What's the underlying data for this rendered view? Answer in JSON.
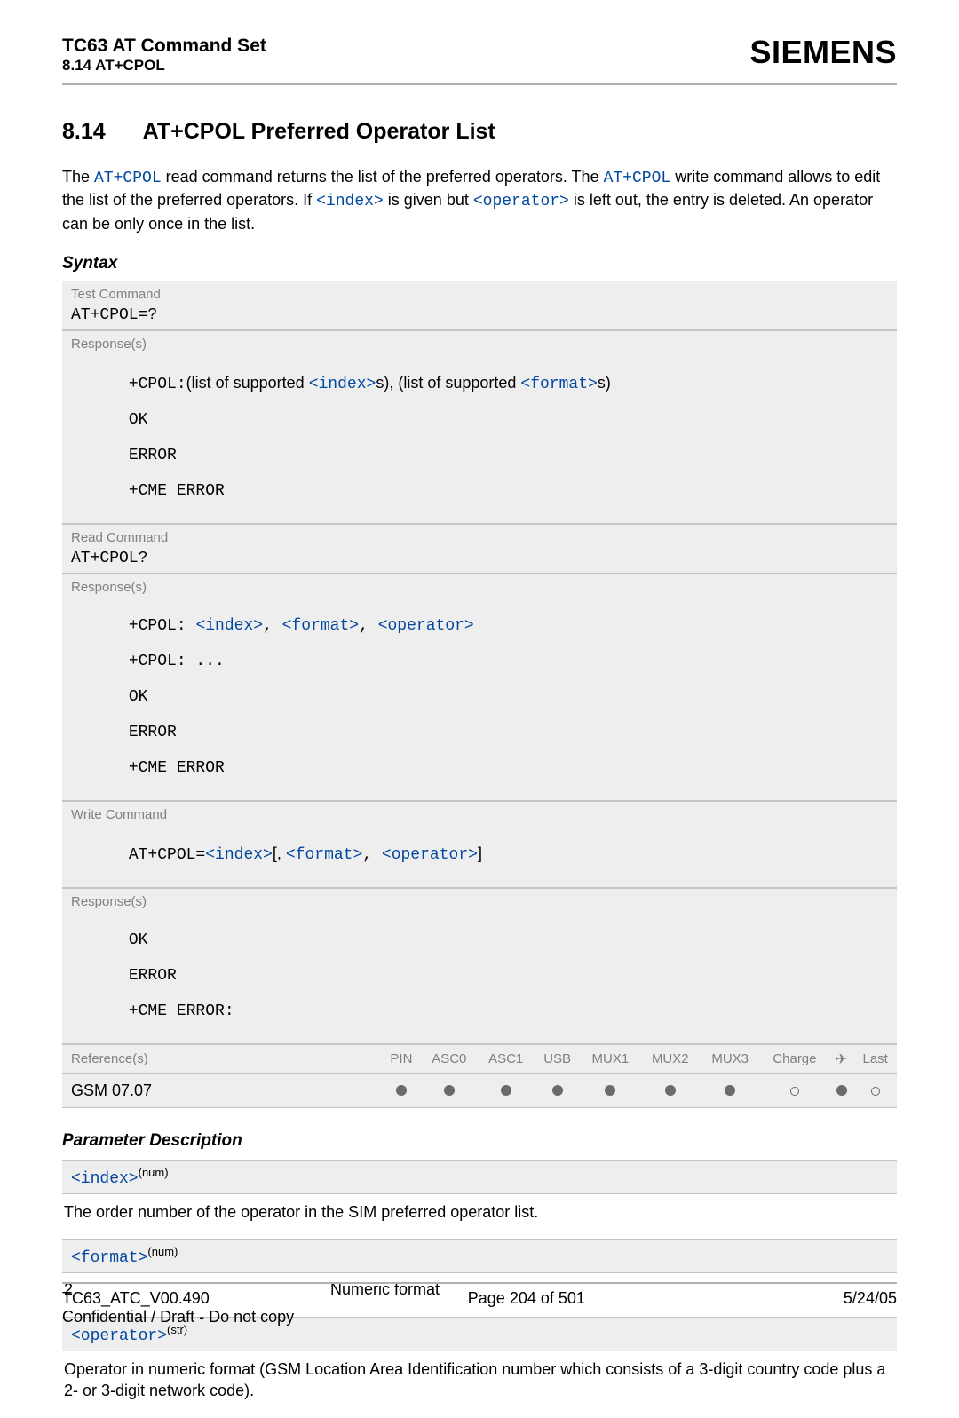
{
  "header": {
    "doc_title": "TC63 AT Command Set",
    "section_ref": "8.14 AT+CPOL",
    "brand": "SIEMENS"
  },
  "heading": {
    "number": "8.14",
    "title": "AT+CPOL   Preferred Operator List"
  },
  "intro": {
    "t1": "The ",
    "c1": "AT+CPOL",
    "t2": " read command returns the list of the preferred operators. The ",
    "c2": "AT+CPOL",
    "t3": " write command allows to edit the list of the preferred operators. If ",
    "c3": "<index>",
    "t4": " is given but ",
    "c4": "<operator>",
    "t5": " is left out, the entry is deleted. An operator can be only once in the list."
  },
  "syntax_label": "Syntax",
  "test_cmd": {
    "label": "Test Command",
    "code": "AT+CPOL=?",
    "resp_label": "Response(s)",
    "line1_pre": "+CPOL:",
    "line1_mid1": "(list of supported ",
    "line1_param1": "<index>",
    "line1_mid2": "s), (list of supported ",
    "line1_param2": "<format>",
    "line1_mid3": "s)",
    "line2": "OK",
    "line3": "ERROR",
    "line4": "+CME ERROR"
  },
  "read_cmd": {
    "label": "Read Command",
    "code": "AT+CPOL?",
    "resp_label": "Response(s)",
    "l1a": "+CPOL: ",
    "p1": "<index>",
    "c": ", ",
    "p2": "<format>",
    "p3": "<operator>",
    "l2": "+CPOL: ...",
    "l3": "OK",
    "l4": "ERROR",
    "l5": "+CME ERROR"
  },
  "write_cmd": {
    "label": "Write Command",
    "pre": "AT+CPOL=",
    "p1": "<index>",
    "b1": "[, ",
    "p2": "<format>",
    "c": ", ",
    "p3": "<operator>",
    "b2": "]",
    "resp_label": "Response(s)",
    "l1": "OK",
    "l2": "ERROR",
    "l3": "+CME ERROR:"
  },
  "refs": {
    "head_ref": "Reference(s)",
    "cols": [
      "PIN",
      "ASC0",
      "ASC1",
      "USB",
      "MUX1",
      "MUX2",
      "MUX3",
      "Charge",
      "✈",
      "Last"
    ],
    "row_label": "GSM 07.07",
    "dots": [
      "f",
      "f",
      "f",
      "f",
      "f",
      "f",
      "f",
      "e",
      "f",
      "e"
    ]
  },
  "param_label": "Parameter Description",
  "params": {
    "index": {
      "name": "<index>",
      "sup": "(num)",
      "desc": "The order number of the operator in the SIM preferred operator list."
    },
    "format": {
      "name": "<format>",
      "sup": "(num)",
      "val": "2",
      "desc": "Numeric format"
    },
    "operator": {
      "name": "<operator>",
      "sup": "(str)",
      "desc": "Operator in numeric format (GSM Location Area Identification number which consists of a 3-digit country code plus a 2- or 3-digit network code)."
    }
  },
  "footer": {
    "left1": "TC63_ATC_V00.490",
    "center": "Page 204 of 501",
    "right": "5/24/05",
    "left2": "Confidential / Draft - Do not copy"
  }
}
